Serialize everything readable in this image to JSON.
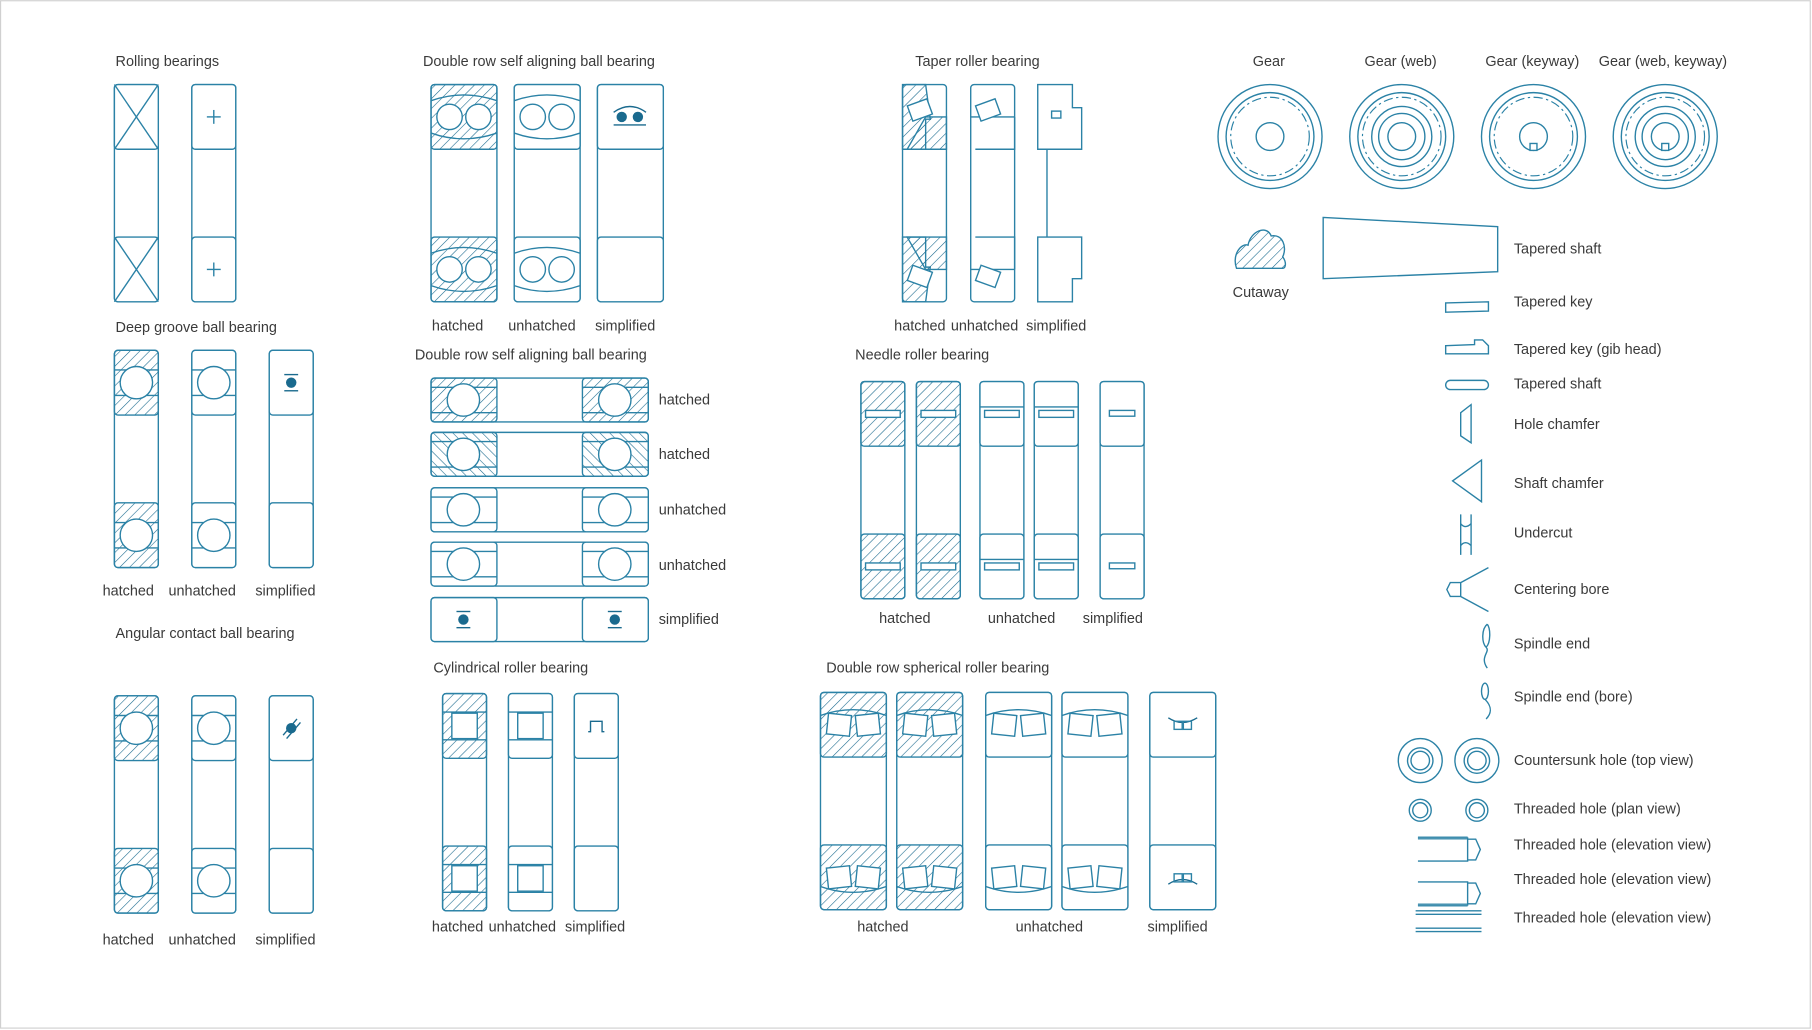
{
  "colors": {
    "stroke": "#2b82a6",
    "dark": "#1a6a8e",
    "text": "#3a3a3a",
    "border": "#d0d0d0"
  },
  "rolling": {
    "title": "Rolling bearings"
  },
  "deep_groove": {
    "title": "Deep groove ball bearing",
    "labels": [
      "hatched",
      "unhatched",
      "simplified"
    ]
  },
  "angular": {
    "title": "Angular contact ball bearing",
    "labels": [
      "hatched",
      "unhatched",
      "simplified"
    ]
  },
  "double_row_v": {
    "title": "Double row self aligning ball bearing",
    "labels": [
      "hatched",
      "unhatched",
      "simplified"
    ]
  },
  "double_row_h": {
    "title": "Double row self aligning ball bearing",
    "labels": [
      "hatched",
      "hatched",
      "unhatched",
      "unhatched",
      "simplified"
    ]
  },
  "cylindrical": {
    "title": "Cylindrical roller bearing",
    "labels": [
      "hatched",
      "unhatched",
      "simplified"
    ]
  },
  "taper": {
    "title": "Taper roller bearing",
    "labels": [
      "hatched",
      "unhatched",
      "simplified"
    ]
  },
  "needle": {
    "title": "Needle roller bearing",
    "labels": [
      "hatched",
      "unhatched",
      "simplified"
    ]
  },
  "spherical": {
    "title": "Double row spherical roller bearing",
    "labels": [
      "hatched",
      "unhatched",
      "simplified"
    ]
  },
  "gears": {
    "titles": [
      "Gear",
      "Gear (web)",
      "Gear (keyway)",
      "Gear (web, keyway)"
    ]
  },
  "cutaway": {
    "label": "Cutaway"
  },
  "symbols": [
    {
      "label": "Tapered shaft",
      "icon": "tapered-shaft-icon"
    },
    {
      "label": "Tapered key",
      "icon": "tapered-key-icon"
    },
    {
      "label": "Tapered key (gib head)",
      "icon": "tapered-key-gib-head-icon"
    },
    {
      "label": "Tapered shaft",
      "icon": "tapered-shaft-round-icon"
    },
    {
      "label": "Hole chamfer",
      "icon": "hole-chamfer-icon"
    },
    {
      "label": "Shaft chamfer",
      "icon": "shaft-chamfer-icon"
    },
    {
      "label": "Undercut",
      "icon": "undercut-icon"
    },
    {
      "label": "Centering bore",
      "icon": "centering-bore-icon"
    },
    {
      "label": "Spindle end",
      "icon": "spindle-end-icon"
    },
    {
      "label": "Spindle end (bore)",
      "icon": "spindle-end-bore-icon"
    },
    {
      "label": "Countersunk hole (top view)",
      "icon": "countersunk-hole-icon"
    },
    {
      "label": "Threaded hole (plan view)",
      "icon": "threaded-hole-plan-icon"
    },
    {
      "label": "Threaded hole (elevation view)",
      "icon": "threaded-hole-elevation-icon"
    },
    {
      "label": "Threaded hole (elevation view)",
      "icon": "threaded-hole-elevation-icon"
    },
    {
      "label": "Threaded hole (elevation view)",
      "icon": "threaded-hole-elevation-icon"
    }
  ]
}
